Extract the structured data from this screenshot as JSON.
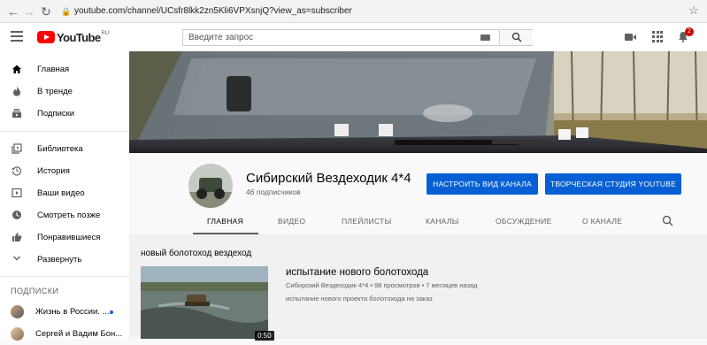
{
  "browser": {
    "url": "youtube.com/channel/UCsfr8lkk2zn5Kli6VPXsnjQ?view_as=subscriber",
    "icons": [
      "back-arrow-icon",
      "forward-arrow-icon",
      "reload-icon",
      "lock-icon",
      "star-icon"
    ]
  },
  "topbar": {
    "logo_text": "YouTube",
    "logo_region": "RU",
    "search_placeholder": "Введите запрос",
    "notification_count": "2"
  },
  "sidebar": {
    "items": [
      {
        "label": "Главная",
        "icon": "home-icon"
      },
      {
        "label": "В тренде",
        "icon": "flame-icon"
      },
      {
        "label": "Подписки",
        "icon": "subscriptions-icon"
      },
      {
        "label": "Библиотека",
        "icon": "library-icon"
      },
      {
        "label": "История",
        "icon": "history-icon"
      },
      {
        "label": "Ваши видео",
        "icon": "your-videos-icon"
      },
      {
        "label": "Смотреть позже",
        "icon": "clock-icon"
      },
      {
        "label": "Понравившиеся",
        "icon": "thumbs-up-icon"
      },
      {
        "label": "Развернуть",
        "icon": "chevron-down-icon"
      }
    ],
    "subscriptions_title": "ПОДПИСКИ",
    "subscriptions": [
      {
        "label": "Жизнь в России. ...",
        "has_new": true
      },
      {
        "label": "Сергей и Вадим Бон..."
      }
    ]
  },
  "channel": {
    "name": "Сибирский Вездеходик 4*4",
    "subscribers": "46 подписчиков",
    "customize_button": "НАСТРОИТЬ ВИД КАНАЛА",
    "studio_button": "ТВОРЧЕСКАЯ СТУДИЯ YOUTUBE",
    "tabs": [
      "ГЛАВНАЯ",
      "ВИДЕО",
      "ПЛЕЙЛИСТЫ",
      "КАНАЛЫ",
      "ОБСУЖДЕНИЕ",
      "О КАНАЛЕ"
    ],
    "active_tab": "ГЛАВНАЯ"
  },
  "content": {
    "shelf_title": "новый болотоход вездеход",
    "video": {
      "title": "испытание нового болотохода",
      "meta": "Сибирский Вездеходик 4*4 • 98 просмотров • 7 месяцев назад",
      "description": "испытание нового проекта болотохода на заказ",
      "duration": "0:50"
    }
  },
  "colors": {
    "brand_red": "#ff0000",
    "action_blue": "#065fd4",
    "sidebar_bg": "#ffffff",
    "page_bg": "#f9f9f9"
  }
}
